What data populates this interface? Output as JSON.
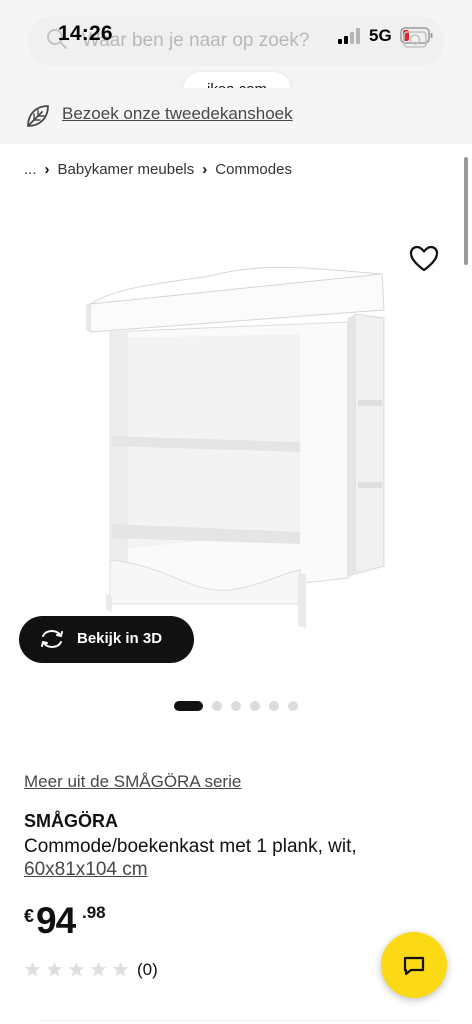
{
  "status_bar": {
    "time": "14:26",
    "network": "5G"
  },
  "browser": {
    "search_placeholder": "Waar ben je naar op zoek?",
    "url": "ikea.com"
  },
  "banner": {
    "link_text": "Bezoek onze tweedekanshoek"
  },
  "breadcrumb": {
    "items": [
      "...",
      "Babykamer meubels",
      "Commodes"
    ],
    "separator": "›"
  },
  "gallery": {
    "view_3d_label": "Bekijk in 3D",
    "image_count": 6,
    "active_index": 0
  },
  "product": {
    "series_link": "Meer uit de SMÅGÖRA serie",
    "name": "SMÅGÖRA",
    "description": "Commode/boekenkast met 1 plank, wit,",
    "size": "60x81x104 cm",
    "price_currency": "€",
    "price_integer": "94",
    "price_decimals": ".98",
    "rating": 0,
    "rating_max": 5,
    "review_count": "(0)"
  },
  "colors": {
    "accent_yellow": "#fbd914",
    "dark": "#111111",
    "banner_bg": "#f5f5f5"
  },
  "icons": [
    "search-icon",
    "camera-icon",
    "leaf-icon",
    "heart-icon",
    "rotate-3d-icon",
    "star-icon",
    "chat-icon"
  ]
}
